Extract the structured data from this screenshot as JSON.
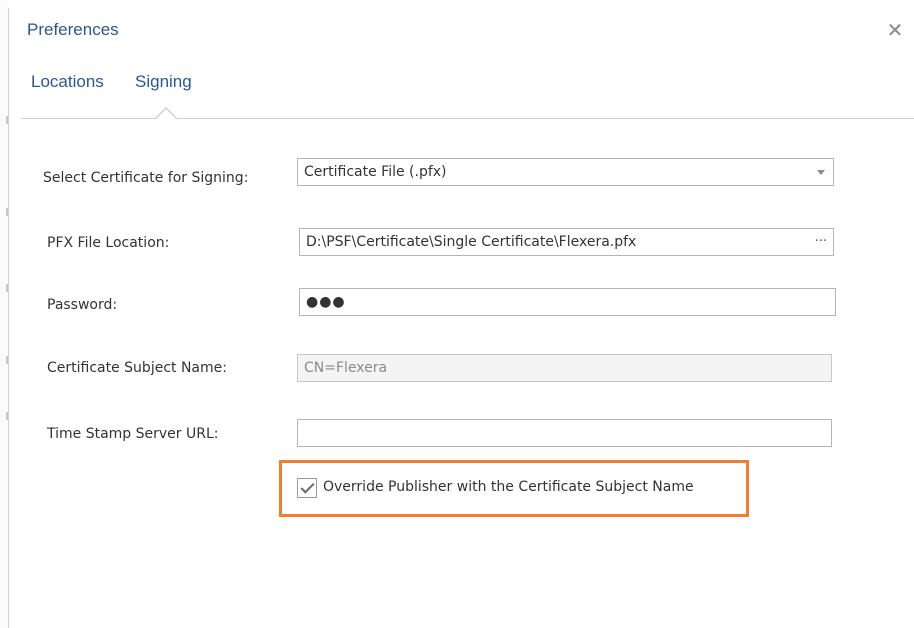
{
  "dialog": {
    "title": "Preferences",
    "close_icon": "close-icon",
    "tabs": [
      {
        "label": "Locations",
        "selected": false
      },
      {
        "label": "Signing",
        "selected": true
      }
    ]
  },
  "signing": {
    "select_cert_label": "Select Certificate for Signing:",
    "select_cert_value": "Certificate File (.pfx)",
    "pfx_label": "PFX File Location:",
    "pfx_value": "D:\\PSF\\Certificate\\Single Certificate\\Flexera.pfx",
    "browse_label": "···",
    "password_label": "Password:",
    "password_value": "●●●",
    "subject_label": "Certificate Subject Name:",
    "subject_value": "CN=Flexera",
    "timestamp_label": "Time Stamp Server URL:",
    "timestamp_value": "",
    "override_label": "Override Publisher with the Certificate Subject Name",
    "override_checked": true
  },
  "colors": {
    "accent": "#2b5797",
    "highlight": "#f07f2d"
  }
}
